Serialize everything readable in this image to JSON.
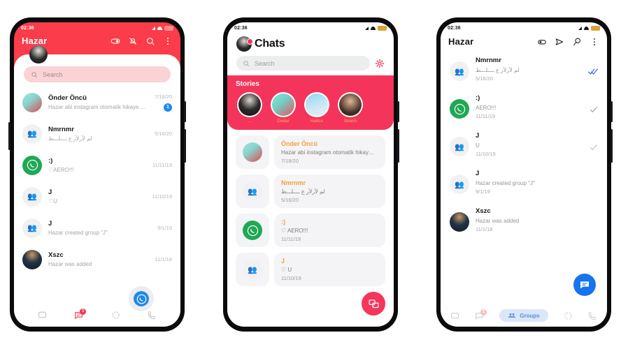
{
  "status_bar": {
    "time": "02:36",
    "icons": [
      "signal-icon",
      "wifi-icon",
      "battery-icon"
    ]
  },
  "colors": {
    "red_primary": "#fb3c4a",
    "pink_stories": "#f5345c",
    "accent_orange": "#f0a13c",
    "blue_badge": "#1d8af0",
    "blue_fab": "#1774f0",
    "whatsapp_green": "#1fa855"
  },
  "phone1": {
    "header": {
      "title": "Hazar",
      "actions": [
        "toggle-switch-icon",
        "bell-off-icon",
        "search-zoom-icon",
        "overflow-menu-icon"
      ]
    },
    "avatar": "profile-avatar",
    "search": {
      "placeholder": "Search",
      "icon": "search-icon"
    },
    "chats": [
      {
        "name": "Önder Öncü",
        "preview": "Hazar abi instagram otomatik hikaye g…",
        "date": "7/18/20",
        "avatar": "person-avatar",
        "badge": "1"
      },
      {
        "name": "Nmrnmr",
        "preview": "لم لآرلآر ع ــــلـــط",
        "date": "5/16/20",
        "avatar": "group-avatar",
        "badge": ""
      },
      {
        "name": ":)",
        "preview": "♡AERO!!!",
        "date": "11/11/19",
        "avatar": "whatsapp-avatar",
        "badge": ""
      },
      {
        "name": "J",
        "preview": "♡U",
        "date": "11/10/19",
        "avatar": "group-avatar",
        "badge": ""
      },
      {
        "name": "J",
        "preview": "Hazar created group \"J\"",
        "date": "9/1/19",
        "avatar": "group-avatar",
        "badge": ""
      },
      {
        "name": "Xszc",
        "preview": "Hazar was added",
        "date": "11/1/18",
        "avatar": "dark-avatar",
        "badge": ""
      }
    ],
    "bottom_nav": [
      {
        "icon": "chats-icon",
        "badge": ""
      },
      {
        "icon": "messages-icon",
        "badge": "1"
      },
      {
        "icon": "status-icon",
        "badge": ""
      },
      {
        "icon": "calls-icon",
        "badge": ""
      }
    ],
    "floating_button": "whatsapp-bubble-icon"
  },
  "phone2": {
    "header": {
      "title": "Chats",
      "avatar": "profile-avatar",
      "notification_dot": true
    },
    "search": {
      "placeholder": "Search",
      "icon": "search-icon",
      "settings_icon": "gear-icon"
    },
    "stories": {
      "title": "Stories",
      "items": [
        {
          "label": "...",
          "avatar": "story-avatar-0"
        },
        {
          "label": "Dedar",
          "avatar": "story-avatar-1"
        },
        {
          "label": "Hatice",
          "avatar": "story-avatar-2"
        },
        {
          "label": "Sinem",
          "avatar": "story-avatar-3"
        }
      ]
    },
    "chats": [
      {
        "name": "Önder Öncü",
        "preview": "Hazar abi instagram otomatik hikay…",
        "date": "7/18/20",
        "avatar": "person-avatar"
      },
      {
        "name": "Nmrnmr",
        "preview": "لم لآرلآر ع ــــلـــط",
        "date": "5/16/20",
        "avatar": "group-avatar"
      },
      {
        "name": ":)",
        "preview": "♡ AERO!!!",
        "date": "11/11/19",
        "avatar": "whatsapp-avatar"
      },
      {
        "name": "J",
        "preview": "♡ U",
        "date": "11/10/19",
        "avatar": "group-avatar"
      }
    ],
    "fab": "new-chat-icon"
  },
  "phone3": {
    "header": {
      "title": "Hazar",
      "actions": [
        "toggle-switch-icon",
        "send-plane-icon",
        "search-zoom-icon",
        "overflow-menu-icon"
      ]
    },
    "chats": [
      {
        "name": "Nmrnmr",
        "preview": "لم لآرلآر ع ــــلـــط",
        "date": "5/16/20",
        "avatar": "group-avatar",
        "tick": "double-check-blue"
      },
      {
        "name": ":)",
        "preview": "AERO!!!",
        "date": "11/11/19",
        "avatar": "whatsapp-avatar",
        "tick": "single-check-grey"
      },
      {
        "name": "J",
        "preview": "U",
        "date": "11/10/19",
        "avatar": "group-avatar",
        "tick": "single-check-grey"
      },
      {
        "name": "J",
        "preview": "Hazar created group \"J\"",
        "date": "9/1/19",
        "avatar": "group-avatar",
        "tick": ""
      },
      {
        "name": "Xszc",
        "preview": "Hazar was added",
        "date": "11/1/18",
        "avatar": "dark-avatar",
        "tick": ""
      }
    ],
    "fab": "new-message-icon",
    "bottom_nav": [
      {
        "icon": "chats-icon",
        "label": "",
        "badge": "",
        "active": false
      },
      {
        "icon": "messages-icon",
        "label": "",
        "badge": "1",
        "active": false
      },
      {
        "icon": "groups-icon",
        "label": "Groups",
        "badge": "",
        "active": true
      },
      {
        "icon": "status-icon",
        "label": "",
        "badge": "",
        "active": false
      },
      {
        "icon": "calls-icon",
        "label": "",
        "badge": "",
        "active": false
      }
    ]
  }
}
